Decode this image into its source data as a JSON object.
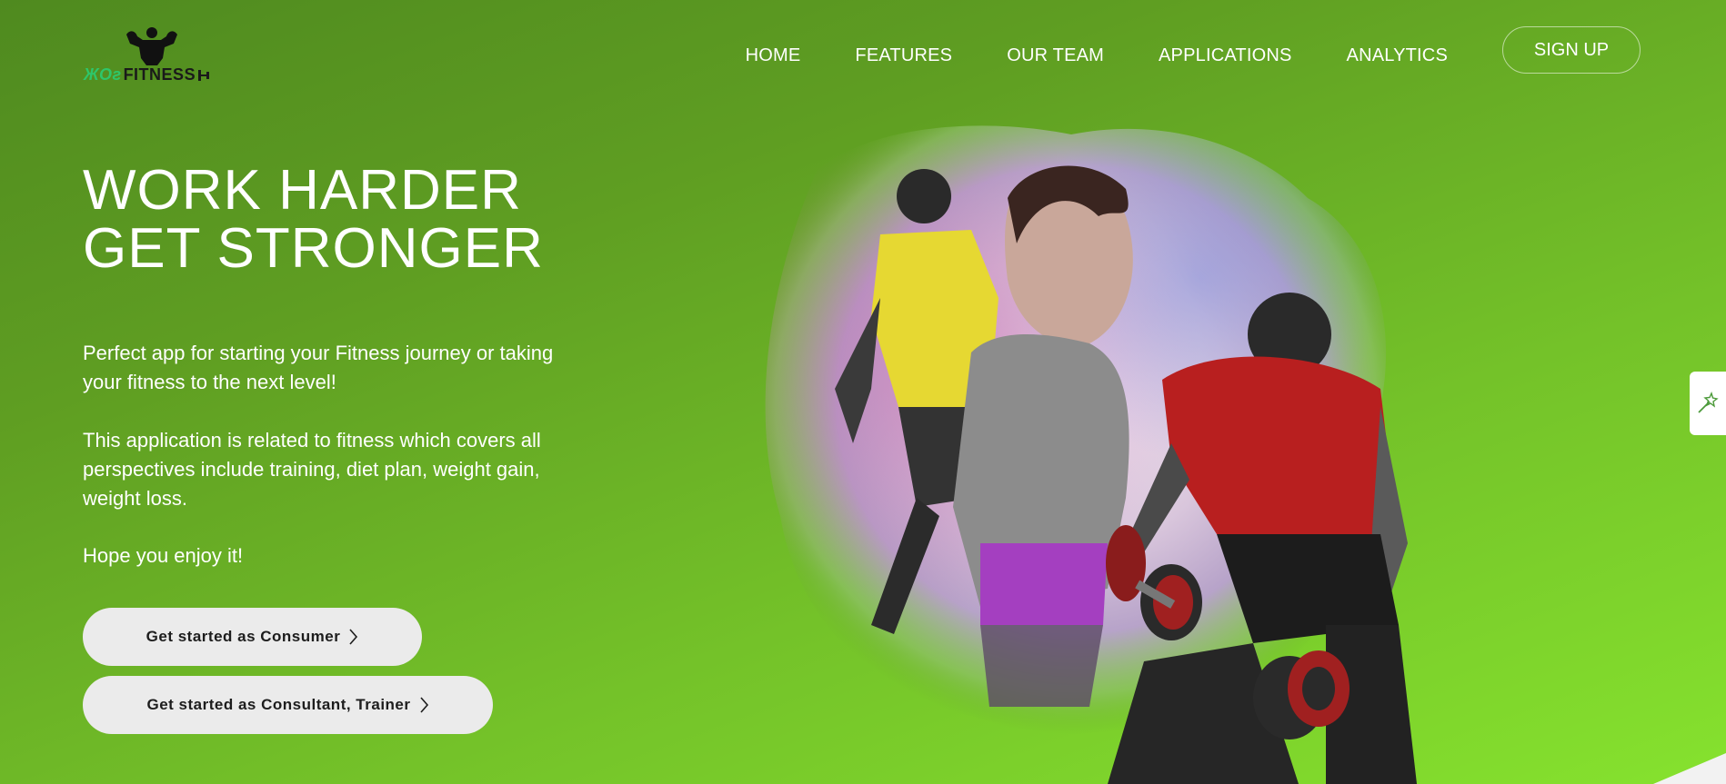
{
  "brand": {
    "logo_prefix": "ЖОг",
    "logo_word": "FITNESS"
  },
  "nav": {
    "items": [
      {
        "label": "HOME"
      },
      {
        "label": "FEATURES"
      },
      {
        "label": "OUR TEAM"
      },
      {
        "label": "APPLICATIONS"
      },
      {
        "label": "ANALYTICS"
      }
    ],
    "signup_label": "SIGN UP"
  },
  "hero": {
    "headline_line1": "WORK HARDER",
    "headline_line2": "GET STRONGER",
    "paragraph1": "Perfect app for starting your Fitness journey or taking your fitness to the next level!",
    "paragraph2": "This application is related to fitness which covers all perspectives include training, diet plan, weight gain, weight loss.",
    "paragraph3": "Hope you enjoy it!",
    "cta_consumer": "Get started as Consumer",
    "cta_trainer": "Get started as Consultant, Trainer"
  },
  "icons": {
    "logo": "bodybuilder-icon",
    "chevron": "chevron-right-icon",
    "side_tab": "magic-wand-icon"
  },
  "colors": {
    "accent": "#5f9e22",
    "accent_light": "#86e22e",
    "button_bg": "#ebebeb",
    "logo_green": "#2ec66a"
  }
}
